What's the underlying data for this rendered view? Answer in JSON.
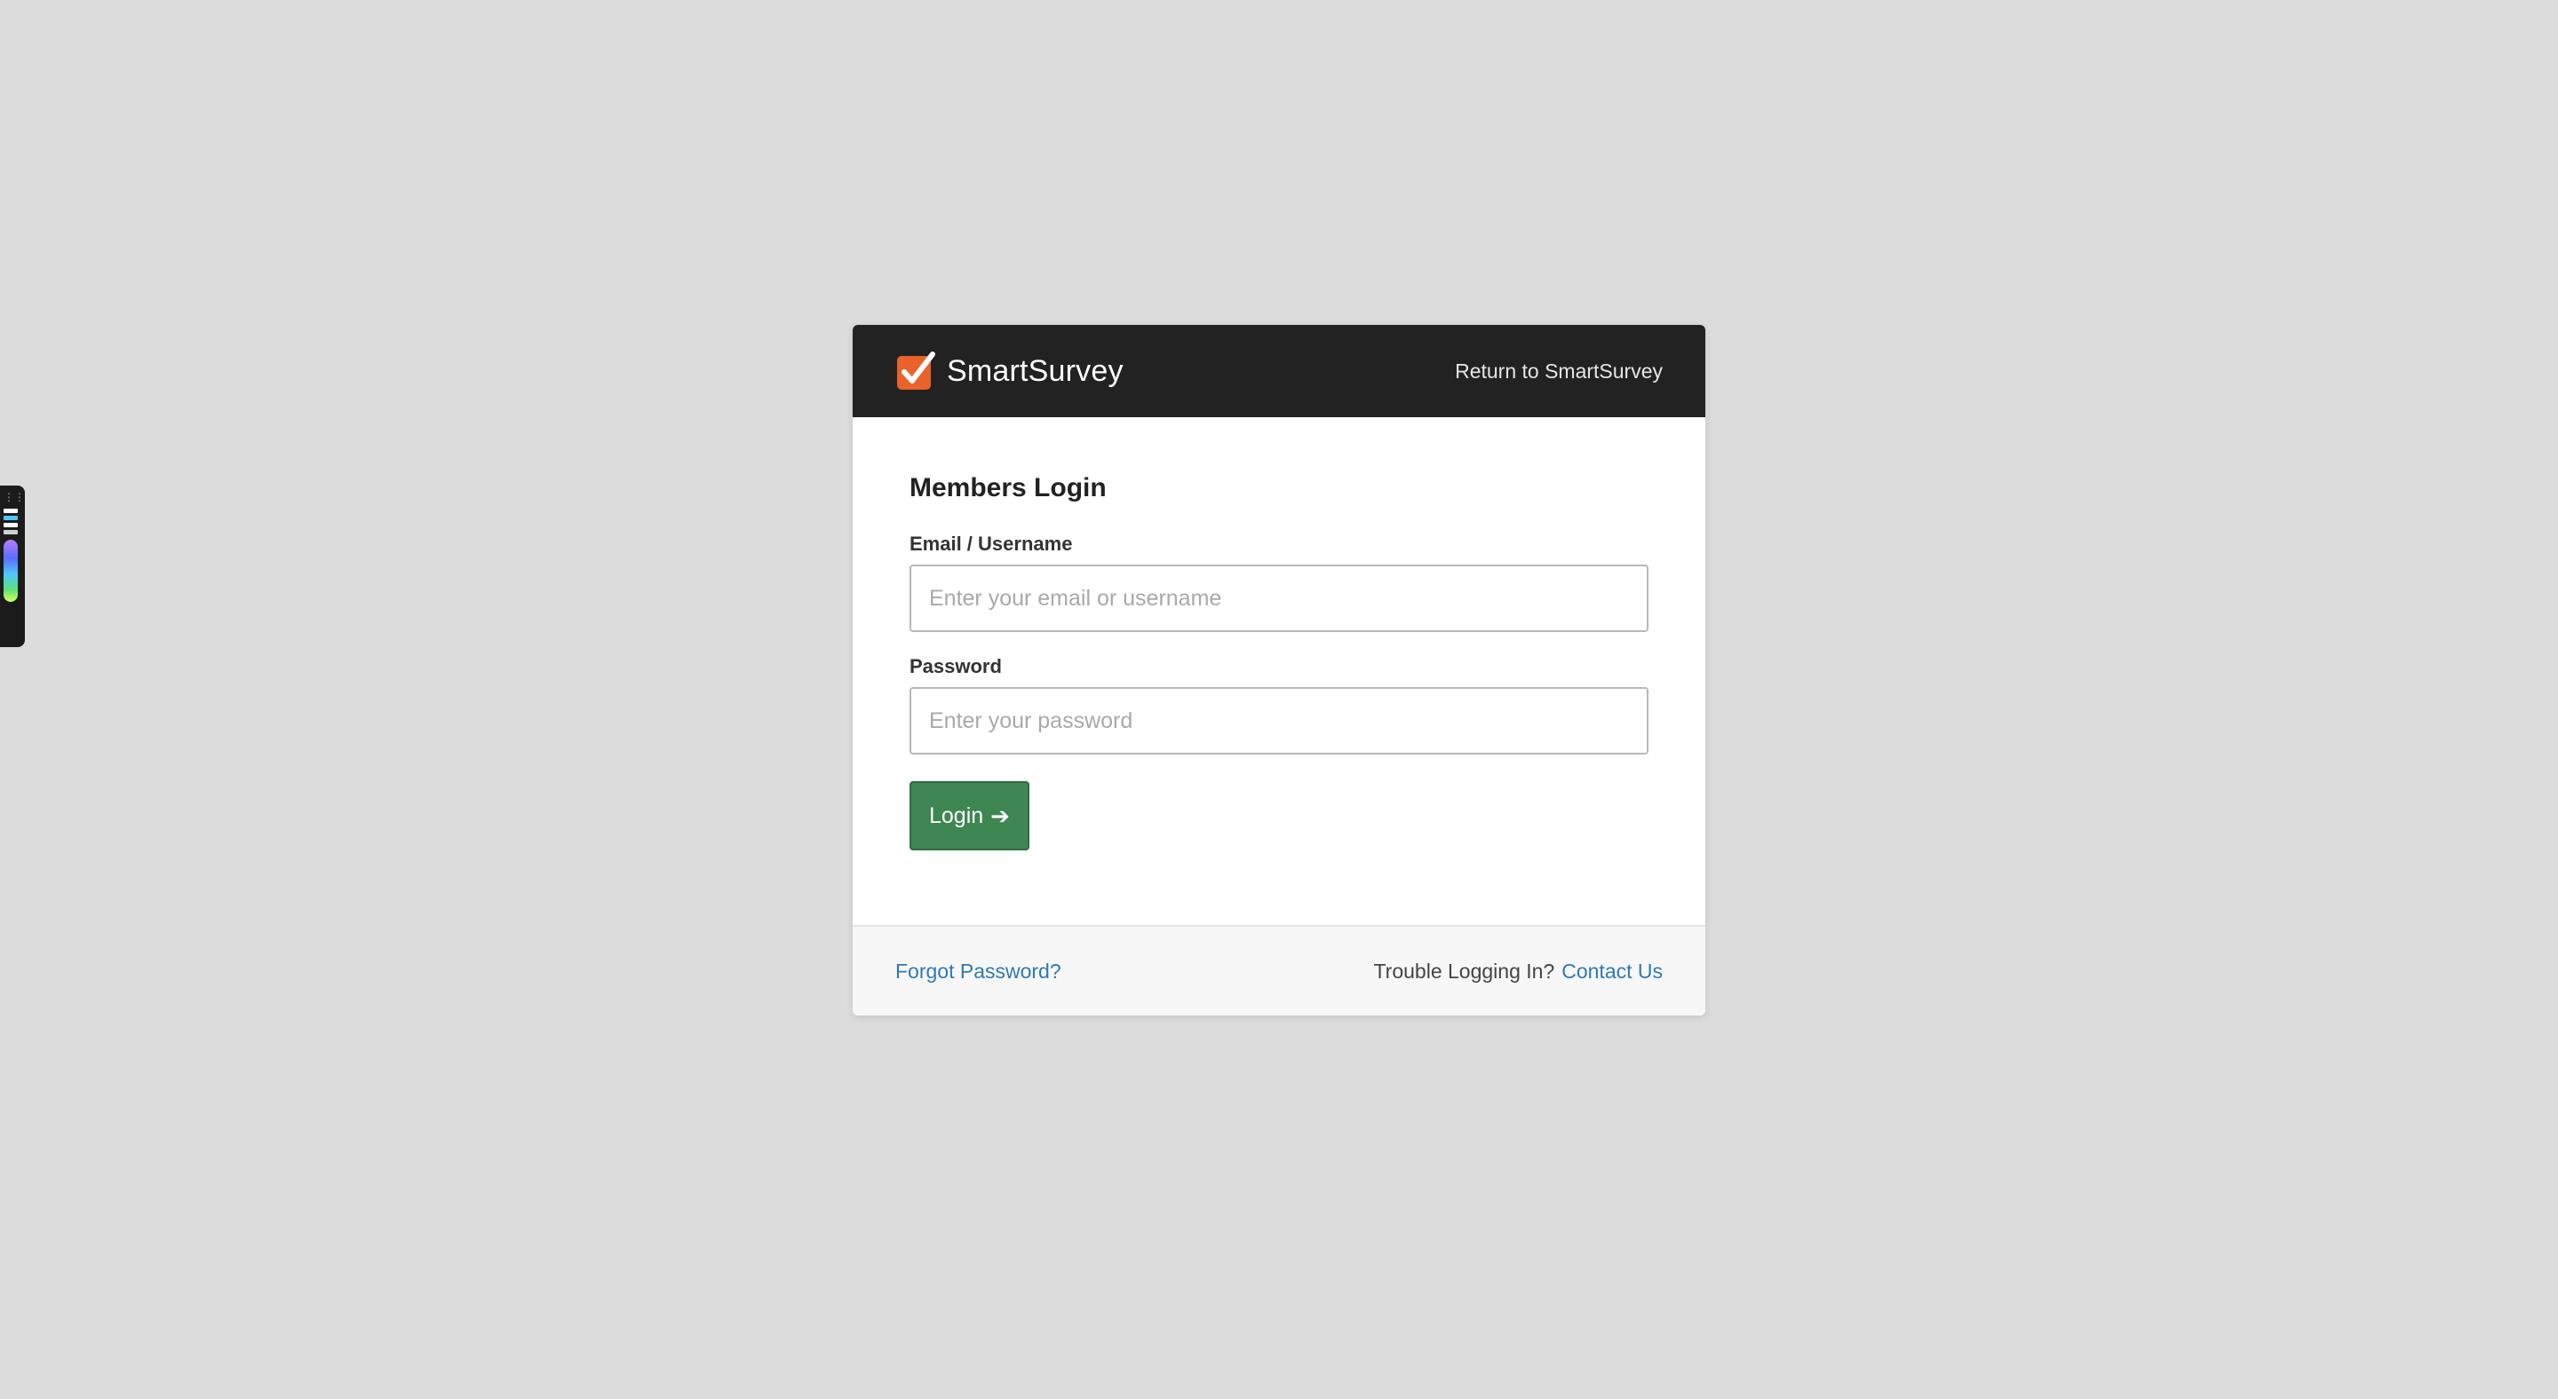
{
  "header": {
    "brand": "SmartSurvey",
    "return_link": "Return to SmartSurvey"
  },
  "form": {
    "title": "Members Login",
    "email_label": "Email / Username",
    "email_placeholder": "Enter your email or username",
    "email_value": "",
    "password_label": "Password",
    "password_placeholder": "Enter your password",
    "password_value": "",
    "login_label": "Login",
    "login_icon": "arrow-right-icon"
  },
  "footer": {
    "forgot_password": "Forgot Password?",
    "trouble_text": "Trouble Logging In?",
    "contact_link": "Contact Us"
  },
  "colors": {
    "header_bg": "#222222",
    "brand_orange": "#e8622a",
    "login_green": "#3e8652",
    "link_blue": "#2f79b5",
    "page_bg": "#dcdcdc"
  }
}
